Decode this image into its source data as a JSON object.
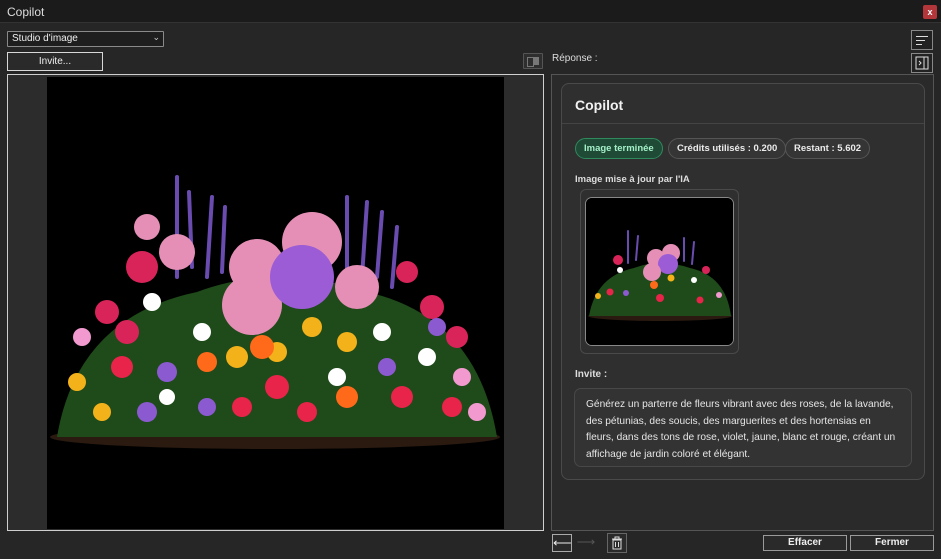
{
  "window": {
    "title": "Copilot",
    "close_glyph": "x"
  },
  "toolbar": {
    "mode_select_value": "Studio d'image",
    "invite_button": "Invite...",
    "response_label": "Réponse :"
  },
  "icons": {
    "compare": "compare-icon",
    "sort": "sort-lines-icon",
    "panel": "panel-toggle-icon",
    "back": "arrow-left-icon",
    "forward": "arrow-right-icon",
    "trash": "trash-icon",
    "dropdown": "chevron-down-icon"
  },
  "card": {
    "title": "Copilot",
    "badges": {
      "status": "Image terminée",
      "credits": "Crédits utilisés : 0.200",
      "remaining": "Restant : 5.602"
    },
    "image_label": "Image mise à jour par l'IA",
    "prompt_label": "Invite :",
    "prompt_text": "Générez un parterre de fleurs vibrant avec des roses, de la lavande, des pétunias, des soucis, des marguerites et des hortensias en fleurs, dans des tons de rose, violet, jaune, blanc et rouge, créant un affichage de jardin coloré et élégant."
  },
  "footer": {
    "clear_button": "Effacer",
    "close_button": "Fermer",
    "back_glyph": "⟵",
    "forward_glyph": "⟶"
  },
  "colors": {
    "accent_success_bg": "#1e4a36",
    "accent_success_text": "#a4f0c8",
    "close_red": "#b3363a",
    "window_bg": "#262626"
  }
}
